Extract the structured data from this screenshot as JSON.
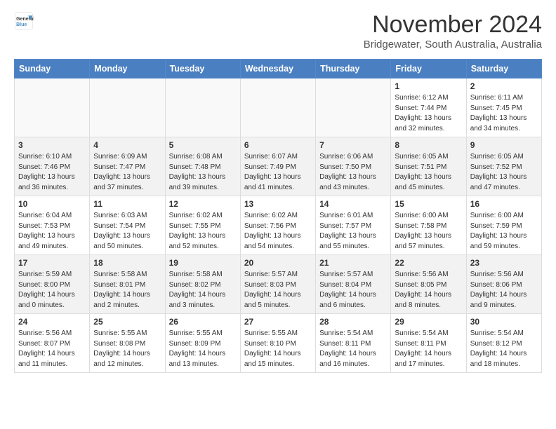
{
  "header": {
    "logo_line1": "General",
    "logo_line2": "Blue",
    "month": "November 2024",
    "location": "Bridgewater, South Australia, Australia"
  },
  "weekdays": [
    "Sunday",
    "Monday",
    "Tuesday",
    "Wednesday",
    "Thursday",
    "Friday",
    "Saturday"
  ],
  "weeks": [
    [
      {
        "day": "",
        "info": ""
      },
      {
        "day": "",
        "info": ""
      },
      {
        "day": "",
        "info": ""
      },
      {
        "day": "",
        "info": ""
      },
      {
        "day": "",
        "info": ""
      },
      {
        "day": "1",
        "info": "Sunrise: 6:12 AM\nSunset: 7:44 PM\nDaylight: 13 hours\nand 32 minutes."
      },
      {
        "day": "2",
        "info": "Sunrise: 6:11 AM\nSunset: 7:45 PM\nDaylight: 13 hours\nand 34 minutes."
      }
    ],
    [
      {
        "day": "3",
        "info": "Sunrise: 6:10 AM\nSunset: 7:46 PM\nDaylight: 13 hours\nand 36 minutes."
      },
      {
        "day": "4",
        "info": "Sunrise: 6:09 AM\nSunset: 7:47 PM\nDaylight: 13 hours\nand 37 minutes."
      },
      {
        "day": "5",
        "info": "Sunrise: 6:08 AM\nSunset: 7:48 PM\nDaylight: 13 hours\nand 39 minutes."
      },
      {
        "day": "6",
        "info": "Sunrise: 6:07 AM\nSunset: 7:49 PM\nDaylight: 13 hours\nand 41 minutes."
      },
      {
        "day": "7",
        "info": "Sunrise: 6:06 AM\nSunset: 7:50 PM\nDaylight: 13 hours\nand 43 minutes."
      },
      {
        "day": "8",
        "info": "Sunrise: 6:05 AM\nSunset: 7:51 PM\nDaylight: 13 hours\nand 45 minutes."
      },
      {
        "day": "9",
        "info": "Sunrise: 6:05 AM\nSunset: 7:52 PM\nDaylight: 13 hours\nand 47 minutes."
      }
    ],
    [
      {
        "day": "10",
        "info": "Sunrise: 6:04 AM\nSunset: 7:53 PM\nDaylight: 13 hours\nand 49 minutes."
      },
      {
        "day": "11",
        "info": "Sunrise: 6:03 AM\nSunset: 7:54 PM\nDaylight: 13 hours\nand 50 minutes."
      },
      {
        "day": "12",
        "info": "Sunrise: 6:02 AM\nSunset: 7:55 PM\nDaylight: 13 hours\nand 52 minutes."
      },
      {
        "day": "13",
        "info": "Sunrise: 6:02 AM\nSunset: 7:56 PM\nDaylight: 13 hours\nand 54 minutes."
      },
      {
        "day": "14",
        "info": "Sunrise: 6:01 AM\nSunset: 7:57 PM\nDaylight: 13 hours\nand 55 minutes."
      },
      {
        "day": "15",
        "info": "Sunrise: 6:00 AM\nSunset: 7:58 PM\nDaylight: 13 hours\nand 57 minutes."
      },
      {
        "day": "16",
        "info": "Sunrise: 6:00 AM\nSunset: 7:59 PM\nDaylight: 13 hours\nand 59 minutes."
      }
    ],
    [
      {
        "day": "17",
        "info": "Sunrise: 5:59 AM\nSunset: 8:00 PM\nDaylight: 14 hours\nand 0 minutes."
      },
      {
        "day": "18",
        "info": "Sunrise: 5:58 AM\nSunset: 8:01 PM\nDaylight: 14 hours\nand 2 minutes."
      },
      {
        "day": "19",
        "info": "Sunrise: 5:58 AM\nSunset: 8:02 PM\nDaylight: 14 hours\nand 3 minutes."
      },
      {
        "day": "20",
        "info": "Sunrise: 5:57 AM\nSunset: 8:03 PM\nDaylight: 14 hours\nand 5 minutes."
      },
      {
        "day": "21",
        "info": "Sunrise: 5:57 AM\nSunset: 8:04 PM\nDaylight: 14 hours\nand 6 minutes."
      },
      {
        "day": "22",
        "info": "Sunrise: 5:56 AM\nSunset: 8:05 PM\nDaylight: 14 hours\nand 8 minutes."
      },
      {
        "day": "23",
        "info": "Sunrise: 5:56 AM\nSunset: 8:06 PM\nDaylight: 14 hours\nand 9 minutes."
      }
    ],
    [
      {
        "day": "24",
        "info": "Sunrise: 5:56 AM\nSunset: 8:07 PM\nDaylight: 14 hours\nand 11 minutes."
      },
      {
        "day": "25",
        "info": "Sunrise: 5:55 AM\nSunset: 8:08 PM\nDaylight: 14 hours\nand 12 minutes."
      },
      {
        "day": "26",
        "info": "Sunrise: 5:55 AM\nSunset: 8:09 PM\nDaylight: 14 hours\nand 13 minutes."
      },
      {
        "day": "27",
        "info": "Sunrise: 5:55 AM\nSunset: 8:10 PM\nDaylight: 14 hours\nand 15 minutes."
      },
      {
        "day": "28",
        "info": "Sunrise: 5:54 AM\nSunset: 8:11 PM\nDaylight: 14 hours\nand 16 minutes."
      },
      {
        "day": "29",
        "info": "Sunrise: 5:54 AM\nSunset: 8:11 PM\nDaylight: 14 hours\nand 17 minutes."
      },
      {
        "day": "30",
        "info": "Sunrise: 5:54 AM\nSunset: 8:12 PM\nDaylight: 14 hours\nand 18 minutes."
      }
    ]
  ]
}
